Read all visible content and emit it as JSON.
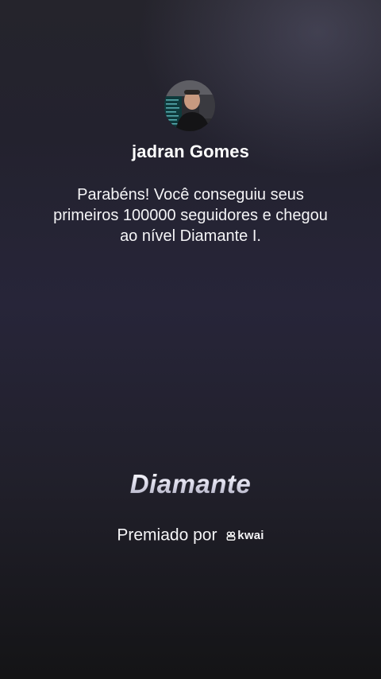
{
  "profile": {
    "username": "jadran Gomes",
    "avatar_icon": "user-avatar"
  },
  "message": "Parabéns! Você conseguiu seus primeiros 100000 seguidores e chegou ao nível Diamante I.",
  "level": {
    "name": "Diamante"
  },
  "awarded": {
    "prefix": "Premiado por",
    "brand_name": "kwai",
    "brand_icon": "kwai-logo-icon"
  }
}
